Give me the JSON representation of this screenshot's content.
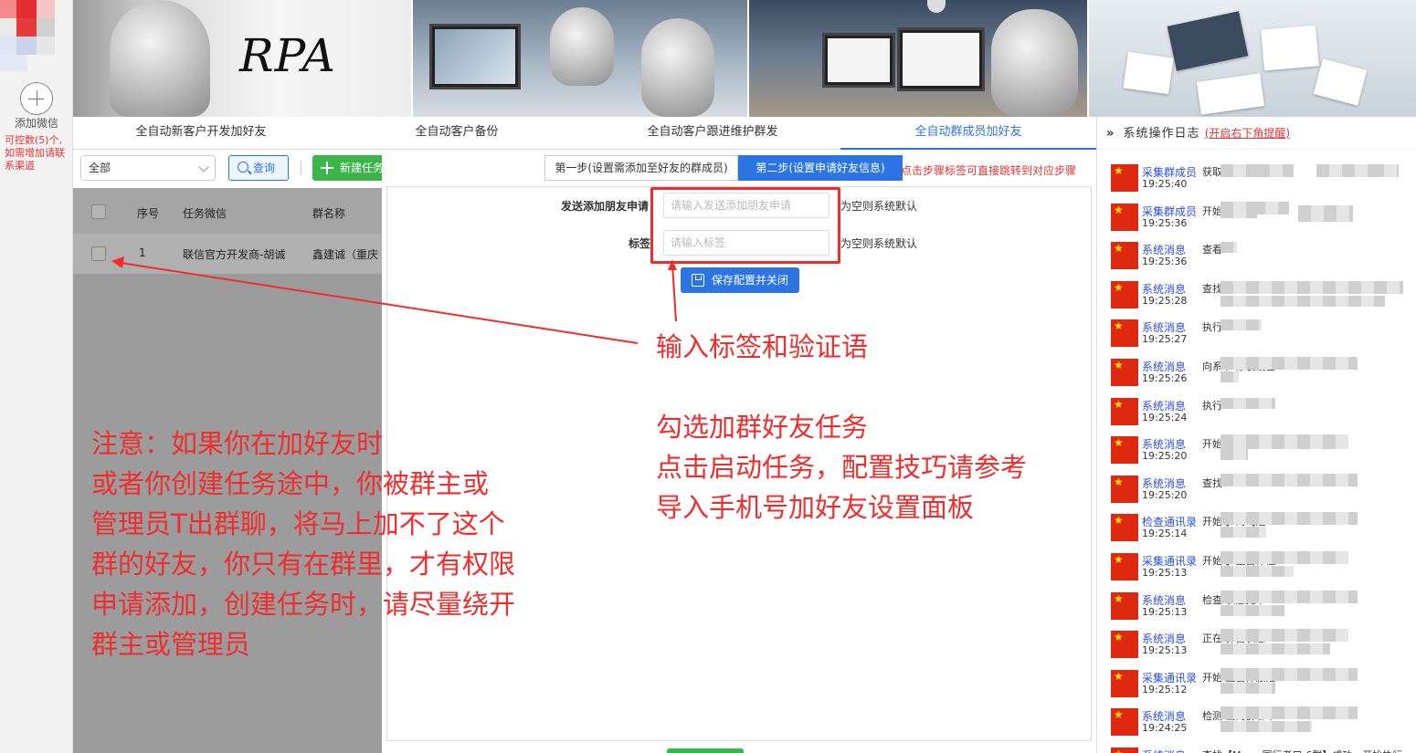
{
  "sidebar": {
    "add_label": "添加微信",
    "quota_text": "可控数(5)个,如需增加请联系渠道"
  },
  "banner": {
    "rpa_text": "RPA"
  },
  "tabs": [
    {
      "label": "全自动新客户开发加好友"
    },
    {
      "label": "全自动客户备份"
    },
    {
      "label": "全自动客户跟进维护群发"
    },
    {
      "label": "全自动群成员加好友"
    }
  ],
  "toolbar": {
    "select_value": "全部",
    "query_label": "查询",
    "new_task_label": "新建任务"
  },
  "table": {
    "headers": [
      "序号",
      "任务微信",
      "群名称"
    ],
    "rows": [
      {
        "index": "1",
        "wechat": "联信官方开发商-胡诚",
        "group": "鑫建诚（重庆"
      }
    ]
  },
  "dialog": {
    "step1_label": "第一步(设置需添加至好友的群成员)",
    "step2_label": "第二步(设置申请好友信息)",
    "step_hint": "点击步骤标签可直接跳转到对应步骤",
    "request_label": "发送添加朋友申请",
    "request_placeholder": "请输入发送添加朋友申请",
    "request_hint": "为空则系统默认",
    "tag_label": "标签",
    "tag_placeholder": "请输入标签",
    "tag_hint": "为空则系统默认",
    "save_label": "保存配置并关闭"
  },
  "log": {
    "title": "系统操作日志",
    "link": "(开启右下角提醒)",
    "items": [
      {
        "type": "采集群成员",
        "time": "19:25:40",
        "msg": "获取"
      },
      {
        "type": "采集群成员",
        "time": "19:25:36",
        "msg": "开始"
      },
      {
        "type": "系统消息",
        "time": "19:25:36",
        "msg": "查看"
      },
      {
        "type": "系统消息",
        "time": "19:25:28",
        "msg": "查找                                    群】成功,"
      },
      {
        "type": "系统消息",
        "time": "19:25:27",
        "msg": "执行"
      },
      {
        "type": "系统消息",
        "time": "19:25:26",
        "msg": "向系                                    ）涂装设备"
      },
      {
        "type": "系统消息",
        "time": "19:25:24",
        "msg": "执行"
      },
      {
        "type": "系统消息",
        "time": "19:25:20",
        "msg": "开始                                    涂设备交流群"
      },
      {
        "type": "系统消息",
        "time": "19:25:20",
        "msg": "查找"
      },
      {
        "type": "检查通讯录",
        "time": "19:25:14",
        "msg": "开始                                    】的【通"
      },
      {
        "type": "采集通讯录",
        "time": "19:25:13",
        "msg": "开始                                    】主窗体位"
      },
      {
        "type": "系统消息",
        "time": "19:25:13",
        "msg": "检查                                    状态完毕"
      },
      {
        "type": "系统消息",
        "time": "19:25:13",
        "msg": "正在                                    弹窗状态"
      },
      {
        "type": "采集通讯录",
        "time": "19:25:12",
        "msg": "开始                                    主窗体激活"
      },
      {
        "type": "系统消息",
        "time": "19:24:25",
        "msg": "检测                                    出的群聊中"
      },
      {
        "type": "系统消息",
        "time": "",
        "msg": "查找【Muse 同行者口-6群】成功，开始执行"
      }
    ]
  },
  "annotations": {
    "input_note": "输入标签和验证语",
    "task_note": [
      "勾选加群好友任务",
      "点击启动任务，配置技巧请参考",
      "导入手机号加好友设置面板"
    ],
    "warning_note": [
      "注意：如果你在加好友时",
      "或者你创建任务途中，你被群主或",
      "管理员T出群聊，将马上加不了这个",
      "群的好友，你只有在群里，才有权限",
      "申请添加，创建任务时，请尽量绕开",
      "群主或管理员"
    ]
  },
  "colors": {
    "primary": "#2b74e2",
    "success": "#3bb44a",
    "annotation": "#f02d2d"
  }
}
